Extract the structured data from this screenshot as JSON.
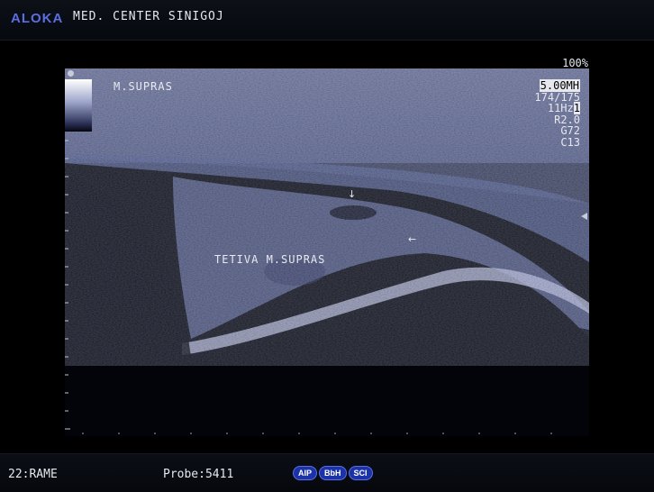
{
  "header": {
    "brand": "ALOKA",
    "institution": "MED. CENTER SINIGOJ"
  },
  "image": {
    "zoom": "100%",
    "params": [
      "5.00MH",
      "174/175",
      "11Hz",
      "R2.0",
      "G72",
      "C13"
    ],
    "param_marker": "1",
    "annotations": {
      "top_label": "M.SUPRAS",
      "tendon_label": "TETIVA M.SUPRAS",
      "arrow_down": "↓",
      "arrow_left": "←"
    }
  },
  "footer": {
    "frame": "22:RAME",
    "probe": "Probe:5411",
    "badges": [
      "AIP",
      "BbH",
      "SCI"
    ]
  },
  "colors": {
    "brand": "#5a6fe0",
    "badge_bg": "#1c33a8",
    "image_tint": "#8a96c8"
  }
}
